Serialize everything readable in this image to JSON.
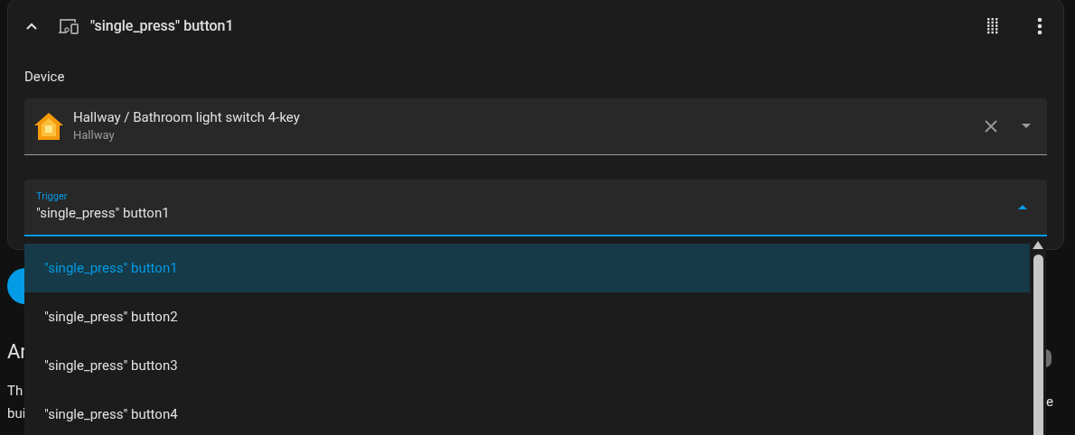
{
  "card": {
    "title": "\"single_press\" button1",
    "expanded": true,
    "device_label": "Device",
    "device": {
      "name": "Hallway / Bathroom light switch 4-key",
      "area": "Hallway"
    },
    "trigger": {
      "label": "Trigger",
      "value": "\"single_press\" button1",
      "open": true
    }
  },
  "dropdown": {
    "options": [
      {
        "label": "\"single_press\" button1",
        "selected": true
      },
      {
        "label": "\"single_press\" button2",
        "selected": false
      },
      {
        "label": "\"single_press\" button3",
        "selected": false
      },
      {
        "label": "\"single_press\" button4",
        "selected": false
      }
    ]
  },
  "background": {
    "heading": "Ar",
    "lines": [
      "Th",
      "bui"
    ],
    "right_fragment": "e"
  }
}
